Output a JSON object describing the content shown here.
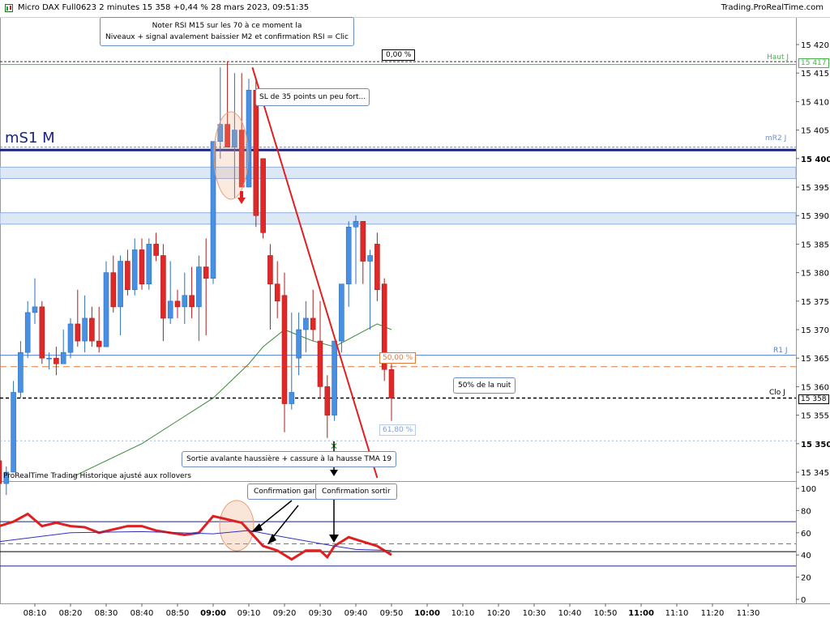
{
  "window": {
    "title": "Micro DAX Full0623 2 minutes 15 358 +0,44 % 28 mars 2023, 09:51:35",
    "brand": "Trading.ProRealTime.com"
  },
  "annotations": {
    "note_rsi": "Noter RSI M15 sur les 70 à ce moment la",
    "note_levels": "Niveaux + signal avalement baissier M2  et confirmation RSI  = Clic",
    "sl": "SL de 35 points un peu fort...",
    "half_night": "50% de la nuit",
    "exit": "Sortie avalante haussière + cassure à la hausse TMA 19",
    "confirm_keep": "Confirmation garder",
    "confirm_exit": "Confirmation sortir",
    "watermark": "ProRealTime Trading  Historique ajusté aux rollovers",
    "zero_pct": "0,00 %",
    "fifty_pct": "50,00 %",
    "fib_618": "61,80 %"
  },
  "levels": {
    "mS1M": "mS1 M",
    "mR2J": "mR2 J",
    "HautJ": "Haut J",
    "R1J": "R1 J",
    "CloJ": "Clo J",
    "haut_value": "15 417",
    "clo_value": "15 358"
  },
  "chart_data": [
    {
      "type": "candlestick",
      "instrument": "Micro DAX Full0623",
      "timeframe": "2 minutes",
      "x_tick_labels": [
        "08:10",
        "08:20",
        "08:30",
        "08:40",
        "08:50",
        "09:00",
        "09:10",
        "09:20",
        "09:30",
        "09:40",
        "09:50",
        "10:00",
        "10:10",
        "10:20",
        "10:30",
        "10:40",
        "10:50",
        "11:00",
        "11:10",
        "11:20",
        "11:30"
      ],
      "y_tick_labels": [
        "15 420",
        "15 415",
        "15 410",
        "15 405",
        "15 400",
        "15 395",
        "15 390",
        "15 385",
        "15 380",
        "15 375",
        "15 370",
        "15 365",
        "15 360",
        "15 355",
        "15 350",
        "15 345"
      ],
      "ylim": [
        15343,
        15423
      ],
      "candles": [
        {
          "t": "08:00",
          "o": 15347,
          "h": 15349,
          "l": 15342,
          "c": 15343
        },
        {
          "t": "08:02",
          "o": 15343,
          "h": 15346,
          "l": 15341,
          "c": 15345
        },
        {
          "t": "08:04",
          "o": 15345,
          "h": 15361,
          "l": 15351,
          "c": 15359
        },
        {
          "t": "08:06",
          "o": 15359,
          "h": 15368,
          "l": 15358,
          "c": 15366
        },
        {
          "t": "08:08",
          "o": 15366,
          "h": 15375,
          "l": 15365,
          "c": 15373
        },
        {
          "t": "08:10",
          "o": 15373,
          "h": 15379,
          "l": 15371,
          "c": 15374
        },
        {
          "t": "08:12",
          "o": 15374,
          "h": 15375,
          "l": 15364,
          "c": 15365
        },
        {
          "t": "08:14",
          "o": 15365,
          "h": 15366,
          "l": 15363,
          "c": 15365
        },
        {
          "t": "08:16",
          "o": 15365,
          "h": 15367,
          "l": 15362,
          "c": 15364
        },
        {
          "t": "08:18",
          "o": 15364,
          "h": 15370,
          "l": 15364,
          "c": 15366
        },
        {
          "t": "08:20",
          "o": 15366,
          "h": 15372,
          "l": 15365,
          "c": 15371
        },
        {
          "t": "08:22",
          "o": 15371,
          "h": 15377,
          "l": 15367,
          "c": 15368
        },
        {
          "t": "08:24",
          "o": 15368,
          "h": 15376,
          "l": 15366,
          "c": 15372
        },
        {
          "t": "08:26",
          "o": 15372,
          "h": 15374,
          "l": 15367,
          "c": 15368
        },
        {
          "t": "08:28",
          "o": 15368,
          "h": 15374,
          "l": 15366,
          "c": 15367
        },
        {
          "t": "08:30",
          "o": 15367,
          "h": 15382,
          "l": 15367,
          "c": 15380
        },
        {
          "t": "08:32",
          "o": 15380,
          "h": 15383,
          "l": 15373,
          "c": 15374
        },
        {
          "t": "08:34",
          "o": 15374,
          "h": 15383,
          "l": 15369,
          "c": 15382
        },
        {
          "t": "08:36",
          "o": 15382,
          "h": 15384,
          "l": 15376,
          "c": 15377
        },
        {
          "t": "08:38",
          "o": 15377,
          "h": 15386,
          "l": 15376,
          "c": 15384
        },
        {
          "t": "08:40",
          "o": 15384,
          "h": 15386,
          "l": 15377,
          "c": 15378
        },
        {
          "t": "08:42",
          "o": 15378,
          "h": 15386,
          "l": 15377,
          "c": 15385
        },
        {
          "t": "08:44",
          "o": 15385,
          "h": 15387,
          "l": 15382,
          "c": 15383
        },
        {
          "t": "08:46",
          "o": 15383,
          "h": 15385,
          "l": 15368,
          "c": 15372
        },
        {
          "t": "08:48",
          "o": 15372,
          "h": 15382,
          "l": 15371,
          "c": 15375
        },
        {
          "t": "08:50",
          "o": 15375,
          "h": 15377,
          "l": 15372,
          "c": 15374
        },
        {
          "t": "08:52",
          "o": 15374,
          "h": 15380,
          "l": 15371,
          "c": 15376
        },
        {
          "t": "08:54",
          "o": 15376,
          "h": 15381,
          "l": 15372,
          "c": 15374
        },
        {
          "t": "08:56",
          "o": 15374,
          "h": 15383,
          "l": 15368,
          "c": 15381
        },
        {
          "t": "08:58",
          "o": 15381,
          "h": 15386,
          "l": 15369,
          "c": 15379
        },
        {
          "t": "09:00",
          "o": 15379,
          "h": 15403,
          "l": 15378,
          "c": 15403
        },
        {
          "t": "09:02",
          "o": 15403,
          "h": 15416,
          "l": 15400,
          "c": 15406
        },
        {
          "t": "09:04",
          "o": 15406,
          "h": 15417,
          "l": 15403,
          "c": 15402
        },
        {
          "t": "09:06",
          "o": 15402,
          "h": 15415,
          "l": 15393,
          "c": 15405
        },
        {
          "t": "09:08",
          "o": 15405,
          "h": 15415,
          "l": 15396,
          "c": 15395
        },
        {
          "t": "09:10",
          "o": 15395,
          "h": 15414,
          "l": 15395,
          "c": 15412
        },
        {
          "t": "09:12",
          "o": 15412,
          "h": 15414,
          "l": 15388,
          "c": 15390
        },
        {
          "t": "09:14",
          "o": 15400,
          "h": 15400,
          "l": 15386,
          "c": 15387
        },
        {
          "t": "09:16",
          "o": 15383,
          "h": 15385,
          "l": 15370,
          "c": 15378
        },
        {
          "t": "09:18",
          "o": 15378,
          "h": 15382,
          "l": 15372,
          "c": 15375
        },
        {
          "t": "09:20",
          "o": 15376,
          "h": 15380,
          "l": 15352,
          "c": 15357
        },
        {
          "t": "09:22",
          "o": 15357,
          "h": 15373,
          "l": 15356,
          "c": 15359
        },
        {
          "t": "09:24",
          "o": 15365,
          "h": 15373,
          "l": 15362,
          "c": 15370
        },
        {
          "t": "09:26",
          "o": 15370,
          "h": 15375,
          "l": 15366,
          "c": 15372
        },
        {
          "t": "09:28",
          "o": 15372,
          "h": 15377,
          "l": 15368,
          "c": 15370
        },
        {
          "t": "09:30",
          "o": 15368,
          "h": 15375,
          "l": 15358,
          "c": 15360
        },
        {
          "t": "09:32",
          "o": 15360,
          "h": 15362,
          "l": 15351,
          "c": 15355
        },
        {
          "t": "09:34",
          "o": 15355,
          "h": 15368,
          "l": 15354,
          "c": 15368
        },
        {
          "t": "09:36",
          "o": 15368,
          "h": 15378,
          "l": 15366,
          "c": 15378
        },
        {
          "t": "09:38",
          "o": 15378,
          "h": 15389,
          "l": 15374,
          "c": 15388
        },
        {
          "t": "09:40",
          "o": 15388,
          "h": 15390,
          "l": 15378,
          "c": 15389
        },
        {
          "t": "09:42",
          "o": 15389,
          "h": 15388,
          "l": 15378,
          "c": 15382
        },
        {
          "t": "09:44",
          "o": 15382,
          "h": 15384,
          "l": 15370,
          "c": 15383
        },
        {
          "t": "09:46",
          "o": 15385,
          "h": 15387,
          "l": 15375,
          "c": 15377
        },
        {
          "t": "09:48",
          "o": 15378,
          "h": 15379,
          "l": 15361,
          "c": 15363
        },
        {
          "t": "09:50",
          "o": 15363,
          "h": 15364,
          "l": 15354,
          "c": 15358
        }
      ],
      "horizontal_levels": [
        {
          "name": "Haut J",
          "value": 15417,
          "color": "#4caf50"
        },
        {
          "name": "mR2 J",
          "value": 15402,
          "color": "#6d8fd0"
        },
        {
          "name": "mS1 M",
          "value": 15401.5,
          "color": "#1a237e"
        },
        {
          "name": "R1 J",
          "value": 15365.5,
          "color": "#4f7fd6"
        },
        {
          "name": "Clo J",
          "value": 15358,
          "color": "#000000"
        },
        {
          "name": "50%",
          "value": 15363.5,
          "color": "#e07a3a"
        },
        {
          "name": "61,80%",
          "value": 15350.5,
          "color": "#9ab3d9"
        }
      ],
      "zones": [
        {
          "from": 15396.5,
          "to": 15398.5
        },
        {
          "from": 15388.5,
          "to": 15390.5
        }
      ],
      "ma": [
        {
          "name": "TMA",
          "color": "#3a8a3a",
          "values": [
            {
              "t": "08:20",
              "v": 15344
            },
            {
              "t": "08:40",
              "v": 15350
            },
            {
              "t": "08:50",
              "v": 15354
            },
            {
              "t": "09:00",
              "v": 15358
            },
            {
              "t": "09:10",
              "v": 15364
            },
            {
              "t": "09:14",
              "v": 15367
            },
            {
              "t": "09:20",
              "v": 15370
            },
            {
              "t": "09:28",
              "v": 15368
            },
            {
              "t": "09:34",
              "v": 15367
            },
            {
              "t": "09:40",
              "v": 15369
            },
            {
              "t": "09:46",
              "v": 15371
            },
            {
              "t": "09:50",
              "v": 15370
            }
          ]
        }
      ],
      "trendline": {
        "from": {
          "t": "09:11",
          "v": 15416
        },
        "to": {
          "t": "09:46",
          "v": 15344
        },
        "color": "#e02020"
      }
    },
    {
      "type": "line",
      "name": "RSI",
      "y_tick_labels": [
        "100",
        "80",
        "60",
        "40",
        "20",
        "0"
      ],
      "ylim": [
        0,
        105
      ],
      "levels": [
        70,
        50,
        43,
        30
      ],
      "series": [
        {
          "color": "#e02020",
          "values": [
            {
              "t": "08:00",
              "v": 66
            },
            {
              "t": "08:04",
              "v": 70
            },
            {
              "t": "08:08",
              "v": 77
            },
            {
              "t": "08:12",
              "v": 66
            },
            {
              "t": "08:16",
              "v": 69
            },
            {
              "t": "08:20",
              "v": 66
            },
            {
              "t": "08:24",
              "v": 65
            },
            {
              "t": "08:28",
              "v": 60
            },
            {
              "t": "08:32",
              "v": 63
            },
            {
              "t": "08:36",
              "v": 66
            },
            {
              "t": "08:40",
              "v": 66
            },
            {
              "t": "08:44",
              "v": 62
            },
            {
              "t": "08:48",
              "v": 60
            },
            {
              "t": "08:52",
              "v": 58
            },
            {
              "t": "08:56",
              "v": 60
            },
            {
              "t": "09:00",
              "v": 75
            },
            {
              "t": "09:04",
              "v": 72
            },
            {
              "t": "09:08",
              "v": 69
            },
            {
              "t": "09:10",
              "v": 62
            },
            {
              "t": "09:14",
              "v": 48
            },
            {
              "t": "09:18",
              "v": 44
            },
            {
              "t": "09:22",
              "v": 36
            },
            {
              "t": "09:26",
              "v": 44
            },
            {
              "t": "09:30",
              "v": 44
            },
            {
              "t": "09:32",
              "v": 38
            },
            {
              "t": "09:34",
              "v": 48
            },
            {
              "t": "09:38",
              "v": 56
            },
            {
              "t": "09:42",
              "v": 52
            },
            {
              "t": "09:46",
              "v": 48
            },
            {
              "t": "09:50",
              "v": 40
            }
          ]
        },
        {
          "color": "#3030c0",
          "values": [
            {
              "t": "08:00",
              "v": 52
            },
            {
              "t": "08:20",
              "v": 60
            },
            {
              "t": "08:40",
              "v": 61
            },
            {
              "t": "09:00",
              "v": 59
            },
            {
              "t": "09:10",
              "v": 62
            },
            {
              "t": "09:20",
              "v": 56
            },
            {
              "t": "09:34",
              "v": 48
            },
            {
              "t": "09:40",
              "v": 45
            },
            {
              "t": "09:50",
              "v": 44
            }
          ]
        }
      ]
    }
  ]
}
